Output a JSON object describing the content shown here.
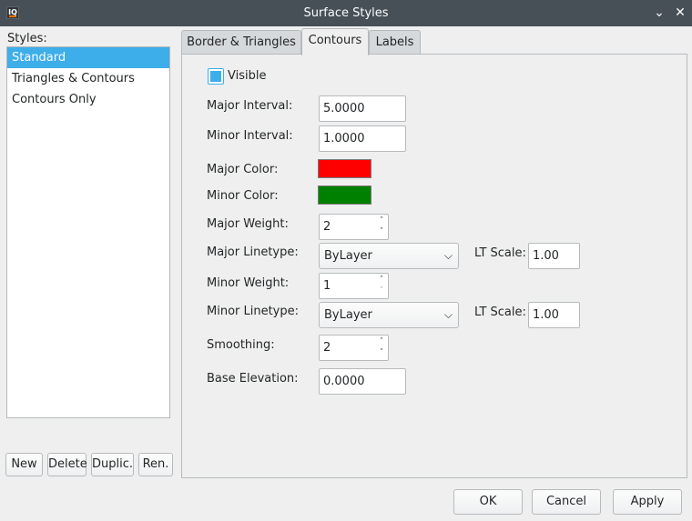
{
  "window": {
    "title": "Surface Styles",
    "app_icon_text": "IQ",
    "minimize_glyph": "⌄",
    "close_glyph": "✕"
  },
  "styles": {
    "label": "Styles:",
    "items": [
      "Standard",
      "Triangles & Contours",
      "Contours Only"
    ],
    "selected_index": 0,
    "buttons": {
      "new": "New",
      "delete": "Delete",
      "duplicate": "Duplic.",
      "rename": "Ren."
    }
  },
  "tabs": {
    "items": [
      "Border & Triangles",
      "Contours",
      "Labels"
    ],
    "active": "Contours"
  },
  "contours": {
    "visible_label": "Visible",
    "visible_checked": true,
    "major_interval": {
      "label": "Major Interval:",
      "value": "5.0000"
    },
    "minor_interval": {
      "label": "Minor Interval:",
      "value": "1.0000"
    },
    "major_color": {
      "label": "Major Color:",
      "color": "#ff0000"
    },
    "minor_color": {
      "label": "Minor Color:",
      "color": "#008000"
    },
    "major_weight": {
      "label": "Major Weight:",
      "value": "2"
    },
    "major_linetype": {
      "label": "Major Linetype:",
      "value": "ByLayer",
      "lt_scale_label": "LT Scale:",
      "lt_scale": "1.00"
    },
    "minor_weight": {
      "label": "Minor Weight:",
      "value": "1"
    },
    "minor_linetype": {
      "label": "Minor Linetype:",
      "value": "ByLayer",
      "lt_scale_label": "LT Scale:",
      "lt_scale": "1.00"
    },
    "smoothing": {
      "label": "Smoothing:",
      "value": "2"
    },
    "base_elevation": {
      "label": "Base Elevation:",
      "value": "0.0000"
    }
  },
  "footer": {
    "ok": "OK",
    "cancel": "Cancel",
    "apply": "Apply"
  }
}
